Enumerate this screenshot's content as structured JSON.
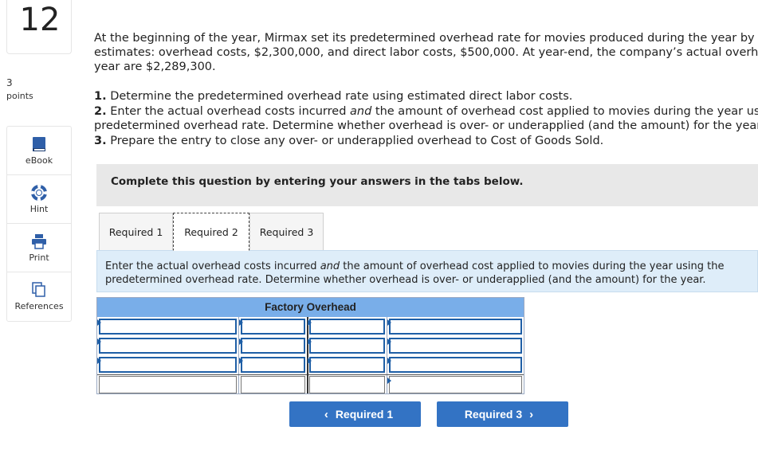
{
  "question": {
    "number": "12",
    "points_value": "3",
    "points_label": "points"
  },
  "tools": [
    {
      "id": "ebook",
      "label": "eBook",
      "icon": "book-icon"
    },
    {
      "id": "hint",
      "label": "Hint",
      "icon": "lifebuoy-icon"
    },
    {
      "id": "print",
      "label": "Print",
      "icon": "printer-icon"
    },
    {
      "id": "references",
      "label": "References",
      "icon": "copy-icon"
    }
  ],
  "stem": {
    "line1": "At the beginning of the year, Mirmax set its predetermined overhead rate for movies produced during the year by using",
    "line2": "estimates: overhead costs, $2,300,000, and direct labor costs, $500,000. At year-end, the company’s actual overhead c",
    "line3": "year are $2,289,300."
  },
  "requirements": {
    "r1_num": "1.",
    "r1_text": " Determine the predetermined overhead rate using estimated direct labor costs.",
    "r2_num": "2.",
    "r2_pre": " Enter the actual overhead costs incurred ",
    "r2_em": "and",
    "r2_post": " the amount of overhead cost applied to movies during the year using th",
    "r2_line2": "predetermined overhead rate. Determine whether overhead is over- or underapplied (and the amount) for the year.",
    "r3_num": "3.",
    "r3_text": " Prepare the entry to close any over- or underapplied overhead to Cost of Goods Sold."
  },
  "banner": "Complete this question by entering your answers in the tabs below.",
  "tabs": [
    "Required 1",
    "Required 2",
    "Required 3"
  ],
  "active_tab": "Required 2",
  "instruction": {
    "pre": "Enter the actual overhead costs incurred ",
    "em": "and",
    "post": " the amount of overhead cost applied to movies during the year using the",
    "line2": "predetermined overhead rate. Determine whether overhead is over- or underapplied (and the amount) for the year."
  },
  "t_account": {
    "title": "Factory Overhead",
    "rows": [
      [
        "",
        "",
        "",
        ""
      ],
      [
        "",
        "",
        "",
        ""
      ],
      [
        "",
        "",
        "",
        ""
      ],
      [
        "",
        "",
        "",
        ""
      ]
    ]
  },
  "nav": {
    "prev_label": "Required 1",
    "next_label": "Required 3"
  },
  "colors": {
    "accent": "#3373c4",
    "table_header": "#79aee9",
    "instruction_bg": "#deedf9",
    "banner_bg": "#e8e8e8"
  }
}
